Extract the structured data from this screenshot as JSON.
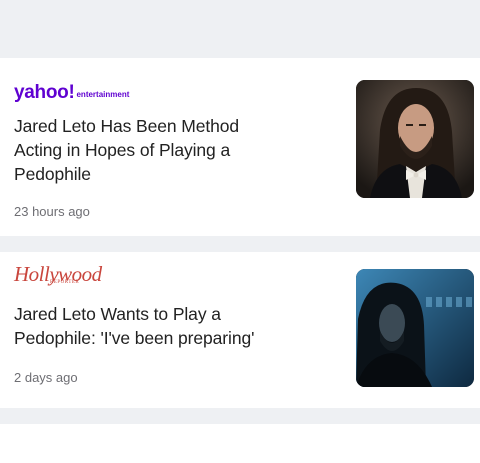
{
  "feed": {
    "items": [
      {
        "publisher_name": "yahoo!",
        "publisher_sub": "entertainment",
        "headline_lines": [
          "Jared Leto Has Been Method",
          "Acting in Hopes of Playing a",
          "Pedophile"
        ],
        "time": "23 hours ago",
        "thumbnail_icon": "portrait-photo"
      },
      {
        "publisher_name": "Hollywood",
        "publisher_sub": "REPORTER",
        "headline_lines": [
          "Jared Leto Wants to Play a",
          "Pedophile: 'I've been preparing'"
        ],
        "time": "2 days ago",
        "thumbnail_icon": "film-still-photo"
      }
    ]
  },
  "colors": {
    "yahoo_purple": "#5f01d1",
    "thr_red": "#c9463d",
    "divider_gray": "#eef0f3"
  }
}
